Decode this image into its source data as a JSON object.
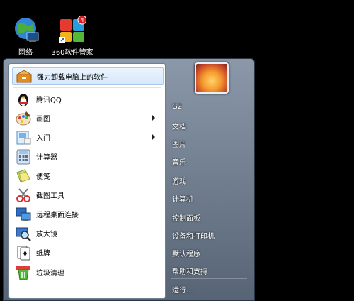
{
  "desktop": {
    "icons": [
      {
        "label": "网络",
        "icon": "network-globe-icon"
      },
      {
        "label": "360软件管家",
        "icon": "360-software-manager-icon",
        "badge": "4"
      }
    ]
  },
  "start_menu": {
    "pinned": {
      "label": "强力卸载电脑上的软件",
      "icon": "uninstaller-icon"
    },
    "items": [
      {
        "label": "腾讯QQ",
        "icon": "qq-penguin-icon",
        "submenu": false
      },
      {
        "label": "画图",
        "icon": "paint-palette-icon",
        "submenu": true
      },
      {
        "label": "入门",
        "icon": "getting-started-icon",
        "submenu": true
      },
      {
        "label": "计算器",
        "icon": "calculator-icon",
        "submenu": false
      },
      {
        "label": "便笺",
        "icon": "sticky-notes-icon",
        "submenu": false
      },
      {
        "label": "截图工具",
        "icon": "snipping-tool-icon",
        "submenu": false
      },
      {
        "label": "远程桌面连接",
        "icon": "remote-desktop-icon",
        "submenu": false
      },
      {
        "label": "放大镜",
        "icon": "magnifier-icon",
        "submenu": false
      },
      {
        "label": "纸牌",
        "icon": "solitaire-icon",
        "submenu": false
      },
      {
        "label": "垃圾清理",
        "icon": "cleanup-icon",
        "submenu": false
      }
    ],
    "right_items": [
      "G2",
      "文档",
      "图片",
      "音乐",
      "游戏",
      "计算机",
      "控制面板",
      "设备和打印机",
      "默认程序",
      "帮助和支持",
      "运行..."
    ],
    "user_picture": "user-avatar-flower-icon"
  }
}
